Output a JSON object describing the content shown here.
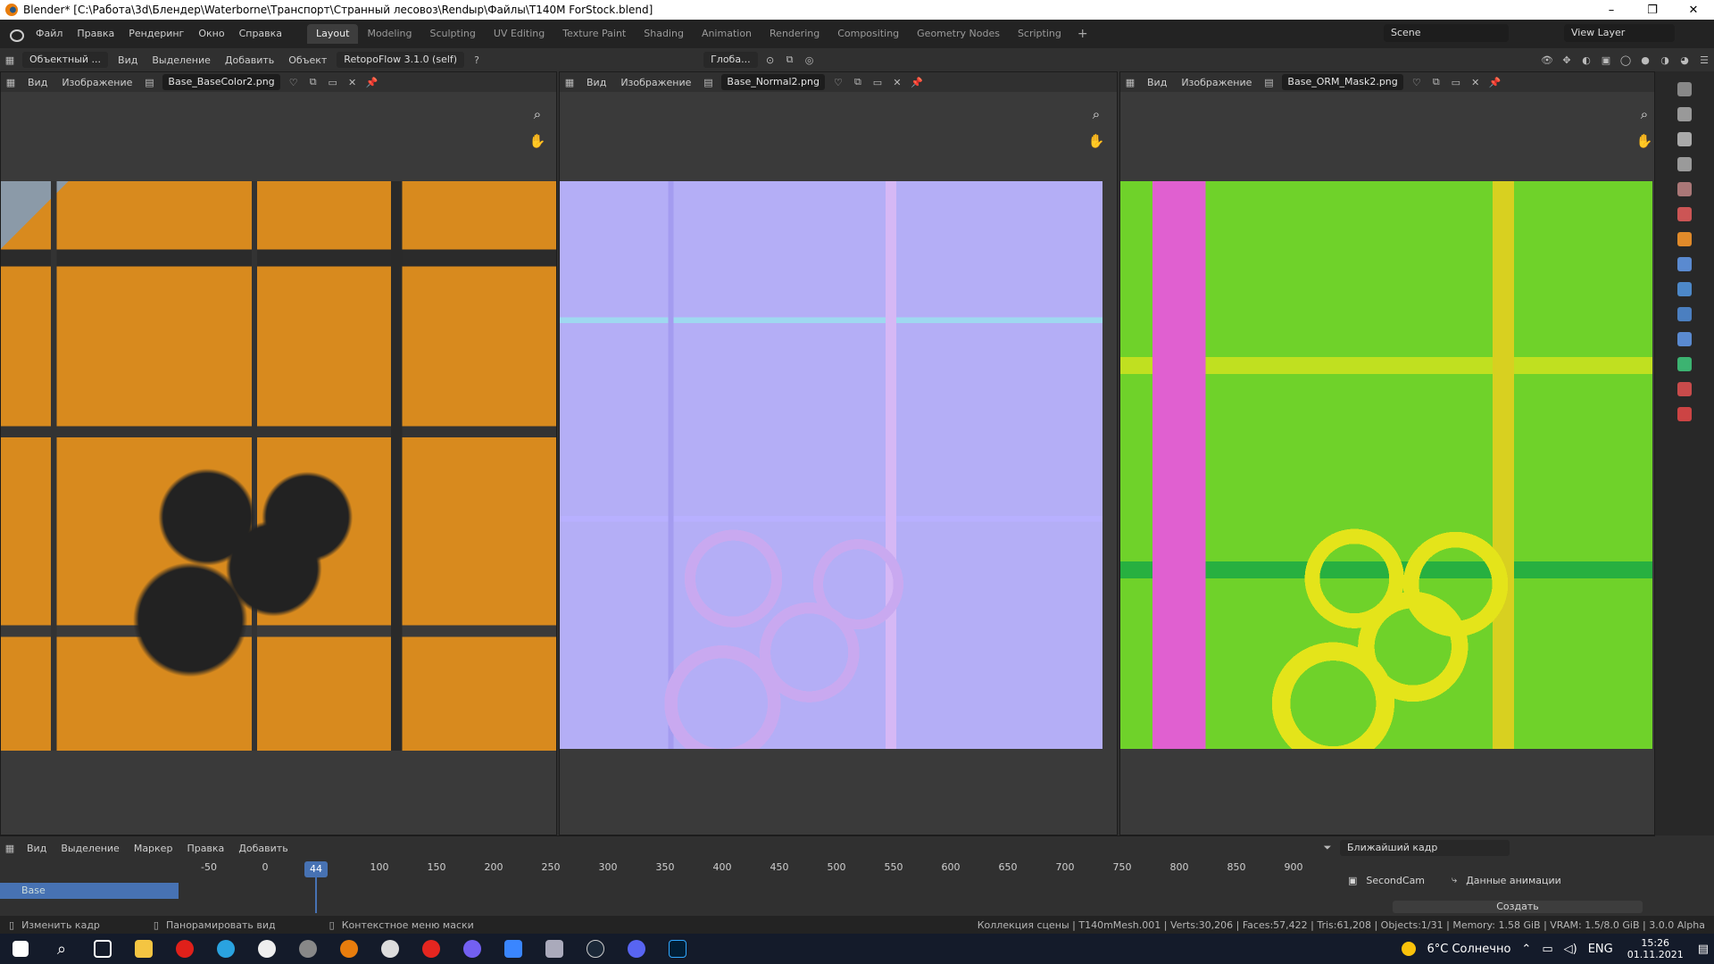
{
  "window": {
    "title": "Blender* [C:\\Работа\\3d\\Блендер\\Waterborne\\Транспорт\\Странный лесовоз\\Rendыр\\Файлы\\T140M ForStock.blend]"
  },
  "menu": [
    "Файл",
    "Правка",
    "Рендеринг",
    "Окно",
    "Справка"
  ],
  "workspaces": [
    "Layout",
    "Modeling",
    "Sculpting",
    "UV Editing",
    "Texture Paint",
    "Shading",
    "Animation",
    "Rendering",
    "Compositing",
    "Geometry Nodes",
    "Scripting"
  ],
  "active_workspace": "Layout",
  "scene": "Scene",
  "view_layer": "View Layer",
  "toolbar": {
    "mode": "Объектный ...",
    "view": "Вид",
    "select": "Выделение",
    "add": "Добавить",
    "object": "Объект",
    "addon": "RetopoFlow 3.1.0 (self)",
    "transform": "Глоба..."
  },
  "editors": [
    {
      "view": "Вид",
      "image_menu": "Изображение",
      "image": "Base_BaseColor2.png"
    },
    {
      "view": "Вид",
      "image_menu": "Изображение",
      "image": "Base_Normal2.png"
    },
    {
      "view": "Вид",
      "image_menu": "Изображение",
      "image": "Base_ORM_Mask2.png"
    }
  ],
  "timeline": {
    "menus": [
      "Вид",
      "Выделение",
      "Маркер",
      "Правка",
      "Добавить"
    ],
    "keying": "Ближайший кадр",
    "current_frame": "44",
    "ticks": [
      "-50",
      "0",
      "100",
      "150",
      "200",
      "250",
      "300",
      "350",
      "400",
      "450",
      "500",
      "550",
      "600",
      "650",
      "700",
      "750",
      "800",
      "850",
      "900"
    ],
    "track": "Base",
    "camera": "SecondCam",
    "anim_data": "Данные анимации",
    "create": "Создать"
  },
  "status": {
    "left1": "Изменить кадр",
    "left2": "Панорамировать вид",
    "left3": "Контекстное меню маски",
    "right": "Коллекция сцены | T140mMesh.001 | Verts:30,206 | Faces:57,422 | Tris:61,208 | Objects:1/31 | Memory: 1.58 GiB | VRAM: 1.5/8.0 GiB | 3.0.0 Alpha"
  },
  "taskbar": {
    "weather": "6°C Солнечно",
    "lang": "ENG",
    "time": "15:26",
    "date": "01.11.2021"
  }
}
